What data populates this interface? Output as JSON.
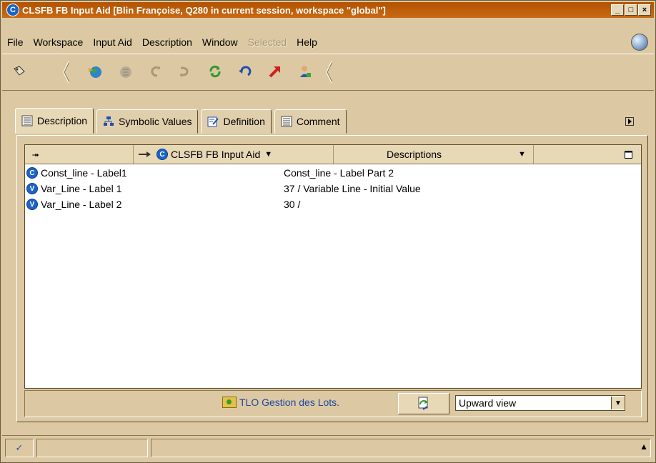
{
  "window": {
    "icon_letter": "C",
    "title": "CLSFB FB Input Aid [Blin Françoise, Q280 in current session, workspace \"global\"]",
    "minimize": "_",
    "maximize": "□",
    "close": "×"
  },
  "menu": {
    "file": "File",
    "workspace": "Workspace",
    "input_aid": "Input Aid",
    "description": "Description",
    "window": "Window",
    "selected": "Selected",
    "help": "Help"
  },
  "toolbar": {
    "icons": [
      "pointer-icon",
      "globe-add-icon",
      "globe-disabled-icon",
      "connect-disabled-icon",
      "disconnect-disabled-icon",
      "refresh-icon",
      "undo-icon",
      "redo-icon",
      "user-icon"
    ]
  },
  "tabs": [
    {
      "label": "Description",
      "icon": "list-icon"
    },
    {
      "label": "Symbolic Values",
      "icon": "sitemap-icon"
    },
    {
      "label": "Definition",
      "icon": "edit-icon"
    },
    {
      "label": "Comment",
      "icon": "list-icon"
    }
  ],
  "table": {
    "header": {
      "expand_symbol": "⯮",
      "object_badge": "C",
      "object_label": "CLSFB FB Input Aid",
      "object_dropdown": "▼",
      "descriptions_label": "Descriptions",
      "descriptions_dropdown": "▼"
    },
    "rows": [
      {
        "badge": "C",
        "name": "Const_line - Label1",
        "value": "Const_line - Label Part 2"
      },
      {
        "badge": "V",
        "name": "Var_Line - Label 1",
        "value": "37 / Variable Line - Initial Value"
      },
      {
        "badge": "V",
        "name": "Var_Line - Label 2",
        "value": "30 /"
      }
    ]
  },
  "bottom": {
    "tlo_label": "TLO Gestion des Lots.",
    "view_select": "Upward view"
  },
  "status": {
    "check": "✓",
    "scroll_up": "▲"
  },
  "colors": {
    "title_bar": "#b35200",
    "window_bg": "#dcc9a3",
    "badge": "#1b63c6",
    "link": "#1f47a0"
  }
}
